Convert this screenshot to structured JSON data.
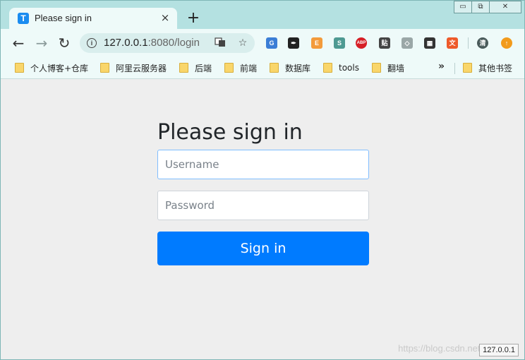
{
  "tab": {
    "title": "Please sign in",
    "favicon_letter": "T",
    "favicon_icon": "t-app-icon",
    "close_icon": "×"
  },
  "new_tab_icon": "+",
  "window_controls": {
    "minimize": "▭",
    "restore": "⧉",
    "close": "✕"
  },
  "toolbar": {
    "back_icon": "←",
    "forward_icon": "→",
    "reload_icon": "↻",
    "url_host": "127.0.0.1",
    "url_rest": ":8080/login",
    "translate_icon": "translate-icon",
    "star_icon": "☆",
    "extensions": [
      {
        "name": "google-translate-icon",
        "glyph": "G",
        "color": "#3b7ed6"
      },
      {
        "name": "quill-icon",
        "glyph": "✒",
        "color": "#222222"
      },
      {
        "name": "e-coin-icon",
        "glyph": "E",
        "color": "#f39b3b"
      },
      {
        "name": "s-icon",
        "glyph": "S",
        "color": "#4e9a92"
      },
      {
        "name": "adblock-plus-icon",
        "glyph": "ABP",
        "color": "#d61f26"
      },
      {
        "name": "tie-icon",
        "glyph": "贴",
        "color": "#444444"
      },
      {
        "name": "shield-icon",
        "glyph": "◇",
        "color": "#9aa7a7"
      },
      {
        "name": "qr-code-icon",
        "glyph": "▦",
        "color": "#333333"
      },
      {
        "name": "translate-zh-icon",
        "glyph": "文",
        "color": "#ee5a2a"
      },
      {
        "name": "profile-avatar-icon",
        "glyph": "清",
        "color": "#4a5b5b"
      },
      {
        "name": "update-icon",
        "glyph": "↑",
        "color": "#f29b1c"
      }
    ]
  },
  "bookmarks": {
    "items": [
      "个人博客+仓库",
      "阿里云服务器",
      "后端",
      "前端",
      "数据库",
      "tools",
      "翻墙"
    ],
    "more_icon": "»",
    "other_label": "其他书签"
  },
  "form": {
    "heading": "Please sign in",
    "username_placeholder": "Username",
    "password_placeholder": "Password",
    "submit_label": "Sign in"
  },
  "watermark": "https://blog.csdn.net/qq_3",
  "status_text": "127.0.0.1"
}
